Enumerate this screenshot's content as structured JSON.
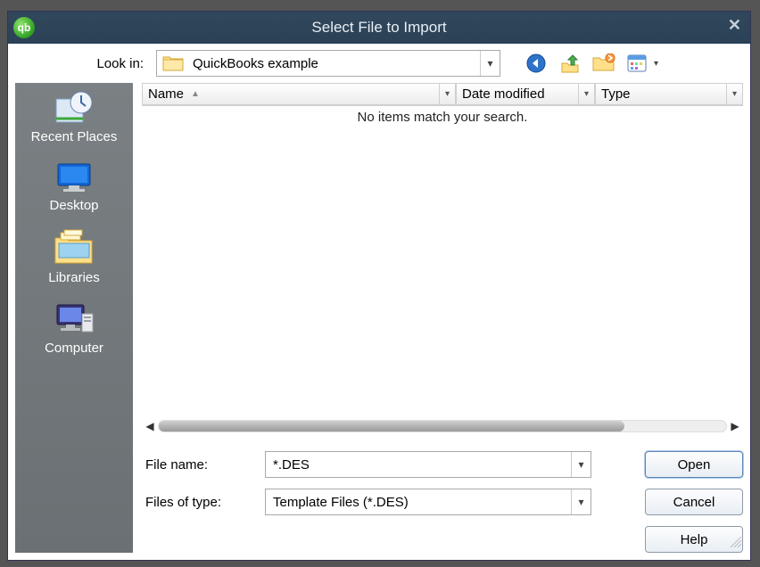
{
  "title": "Select File to Import",
  "look_in": {
    "label": "Look in:",
    "folder_name": "QuickBooks example"
  },
  "columns": {
    "name": "Name",
    "date_modified": "Date modified",
    "type": "Type"
  },
  "listing": {
    "empty_message": "No items match your search."
  },
  "places": [
    {
      "label": "Recent Places"
    },
    {
      "label": "Desktop"
    },
    {
      "label": "Libraries"
    },
    {
      "label": "Computer"
    }
  ],
  "file_name": {
    "label": "File name:",
    "value": "*.DES"
  },
  "file_type": {
    "label": "Files of type:",
    "value": "Template Files (*.DES)"
  },
  "buttons": {
    "open": "Open",
    "cancel": "Cancel",
    "help": "Help"
  }
}
